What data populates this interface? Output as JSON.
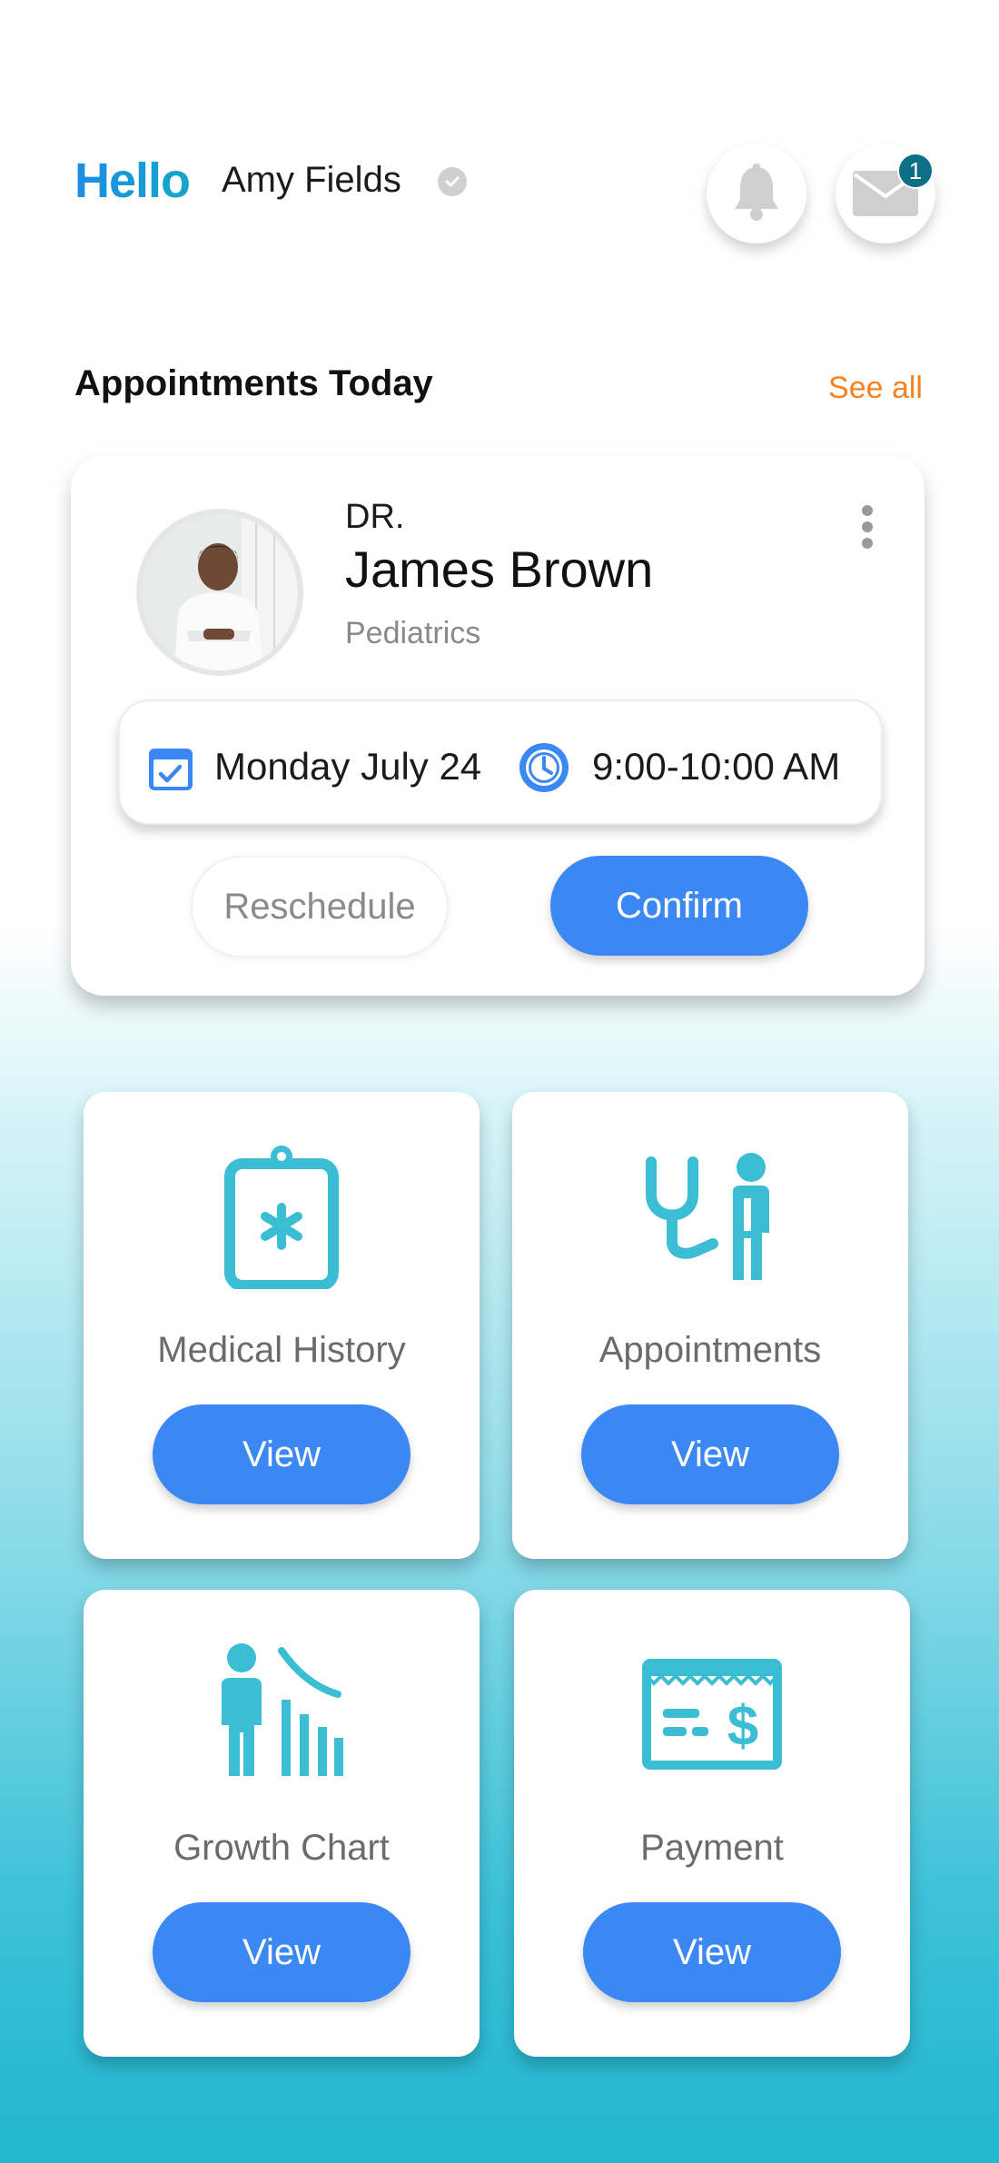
{
  "header": {
    "greeting": "Hello",
    "user_name": "Amy Fields",
    "mail_badge_count": "1",
    "icons": [
      "verified-icon",
      "bell-icon",
      "mail-icon"
    ]
  },
  "appointments_section": {
    "title": "Appointments Today",
    "see_all_label": "See all"
  },
  "appointment": {
    "doctor_prefix": "DR.",
    "doctor_name": "James Brown",
    "specialty": "Pediatrics",
    "date": "Monday July 24",
    "time": "9:00-10:00 AM",
    "reschedule_label": "Reschedule",
    "confirm_label": "Confirm"
  },
  "tiles": [
    {
      "label": "Medical History",
      "button_label": "View",
      "icon": "clipboard-medical-icon"
    },
    {
      "label": "Appointments",
      "button_label": "View",
      "icon": "stethoscope-doctor-icon"
    },
    {
      "label": "Growth Chart",
      "button_label": "View",
      "icon": "growth-chart-icon"
    },
    {
      "label": "Payment",
      "button_label": "View",
      "icon": "payment-check-icon"
    }
  ],
  "colors": {
    "primary_button": "#3b88f5",
    "accent_link": "#f5821f",
    "icon_teal": "#3bbdd4",
    "greeting_gradient_start": "#1b8ee6",
    "badge": "#0c6f86"
  }
}
